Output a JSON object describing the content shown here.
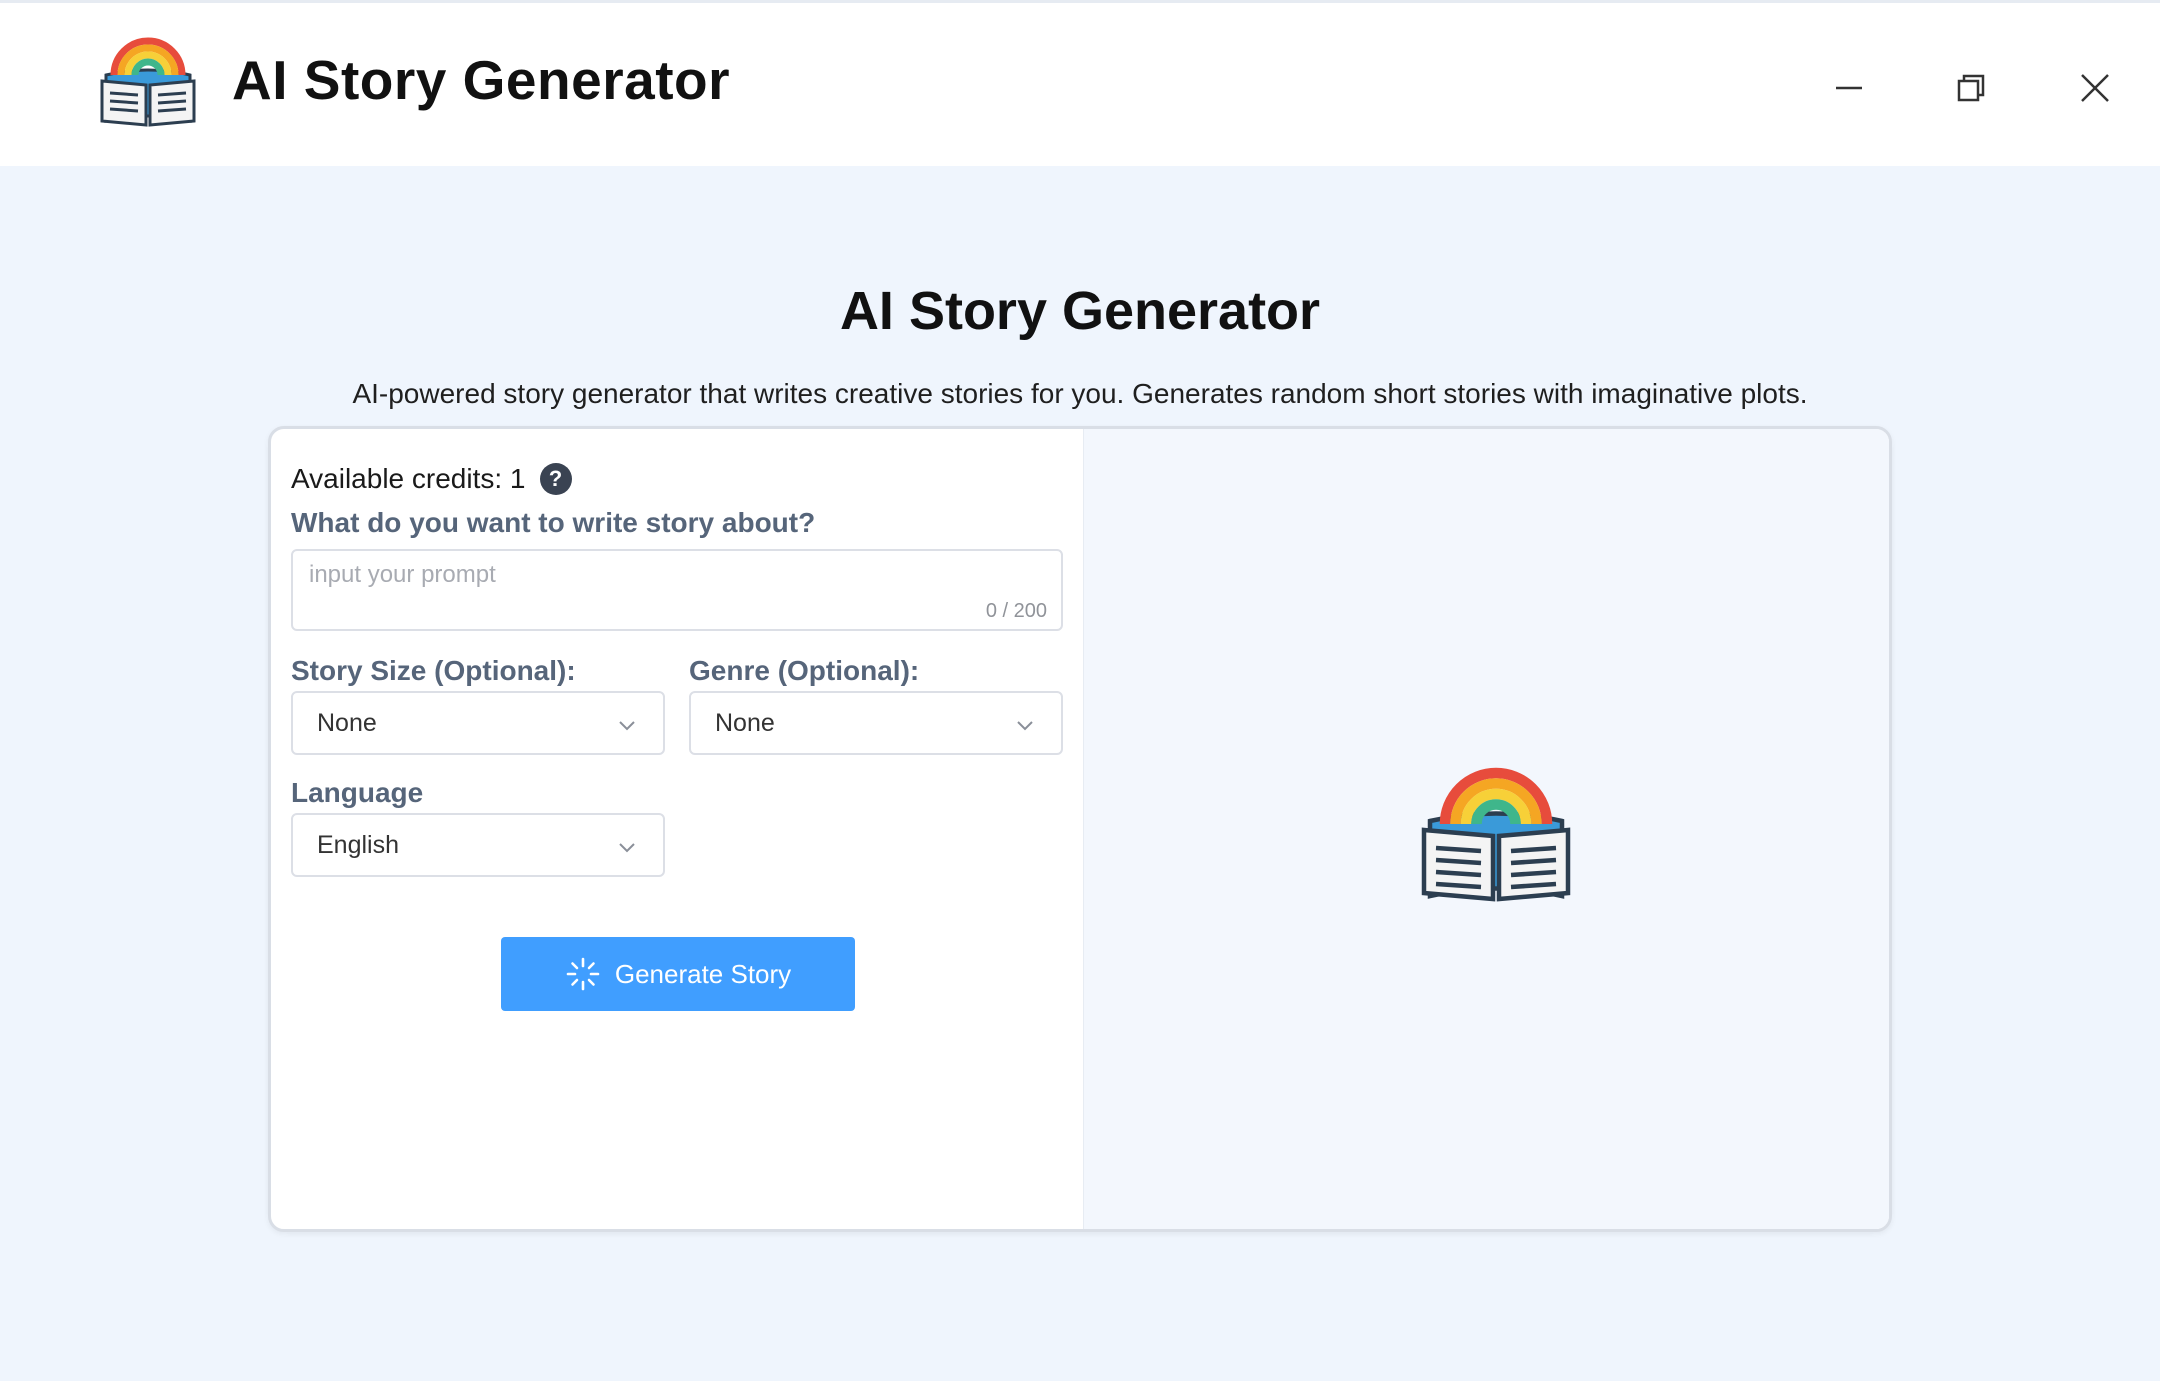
{
  "window": {
    "title": "AI Story Generator",
    "controls": {
      "minimize": "minimize-icon",
      "maximize": "restore-icon",
      "close": "close-icon"
    }
  },
  "page": {
    "title": "AI Story Generator",
    "subtitle": "AI-powered story generator that writes creative stories for you. Generates random short stories with imaginative plots."
  },
  "form": {
    "credits_label": "Available credits: 1",
    "help_symbol": "?",
    "prompt_label": "What do you want to write story about?",
    "prompt_value": "",
    "prompt_placeholder": "input your prompt",
    "prompt_counter": "0 / 200",
    "story_size_label": "Story Size (Optional):",
    "story_size_value": "None",
    "genre_label": "Genre (Optional):",
    "genre_value": "None",
    "language_label": "Language",
    "language_value": "English",
    "generate_label": "Generate Story"
  },
  "colors": {
    "accent": "#409eff",
    "label": "#56657a",
    "page_bg": "#eff5fd",
    "rainbow": [
      "#e74c3c",
      "#f5a623",
      "#f7d038",
      "#3fb68b",
      "#3a9ad9"
    ]
  }
}
